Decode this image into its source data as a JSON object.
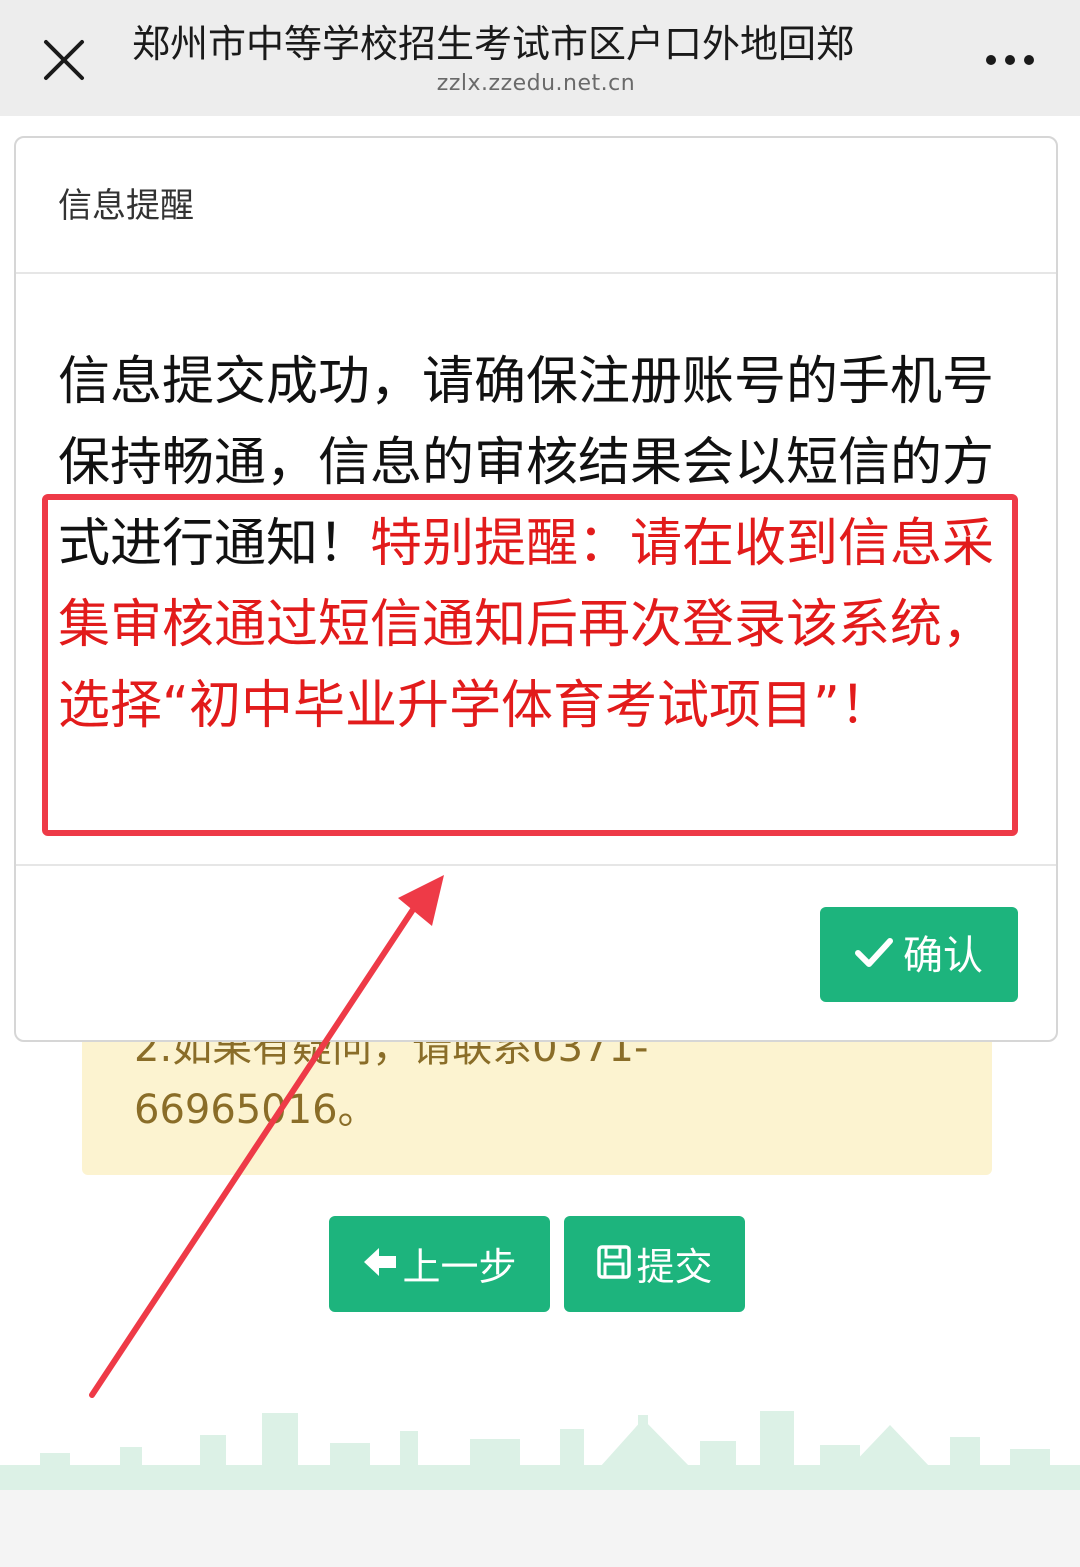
{
  "browser": {
    "title": "郑州市中等学校招生考试市区户口外地回郑",
    "url": "zzlx.zzedu.net.cn",
    "close_icon": "close-icon",
    "more_icon": "more-icon"
  },
  "page": {
    "notice_partial_line": "2.如果有疑问，请联系0371-",
    "notice_phone_line": "66965016。",
    "prev_button": "上一步",
    "prev_icon": "arrow-left-icon",
    "submit_button": "提交",
    "submit_icon": "save-icon"
  },
  "modal": {
    "title": "信息提醒",
    "message_normal": "信息提交成功，请确保注册账号的手机号保持畅通，信息的审核结果会以短信的方式进行通知！",
    "message_highlight": "特别提醒：请在收到信息采集审核通过短信通知后再次登录该系统，选择“初中毕业升学体育考试项目”！",
    "confirm_button": "确认",
    "confirm_icon": "check-icon"
  },
  "colors": {
    "accent_green": "#1db47d",
    "highlight_red": "#e21b1b",
    "annotation_red": "#ee3a47",
    "notice_bg": "#fcf3d0",
    "topbar_bg": "#ededed"
  }
}
